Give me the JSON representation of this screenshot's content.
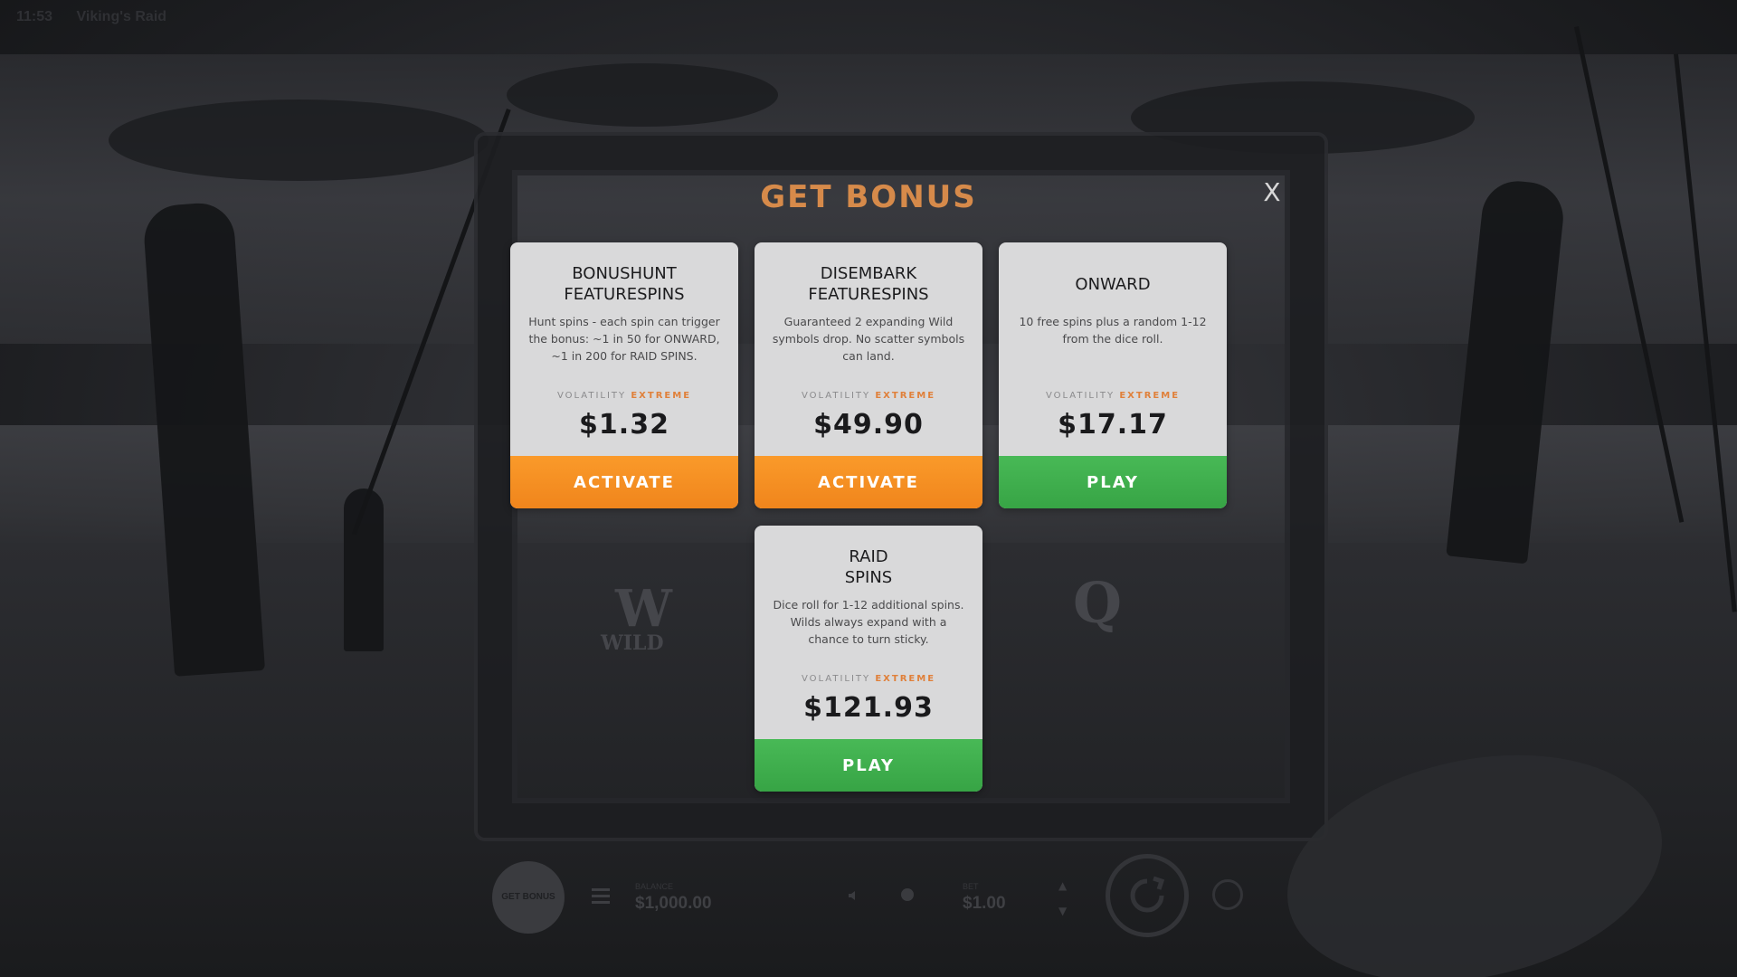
{
  "game": {
    "clock": "11:53",
    "name": "Viking's Raid"
  },
  "background": {
    "reel_symbols": [
      "W",
      "WILD",
      "Q"
    ]
  },
  "controls": {
    "get_bonus": "GET BONUS",
    "balance_label": "BALANCE",
    "balance_value": "$1,000.00",
    "bet_label": "BET",
    "bet_value": "$1.00"
  },
  "modal": {
    "title": "GET BONUS",
    "close": "X",
    "cards": [
      {
        "title": "BONUSHUNT\nFEATURESPINS",
        "description": "Hunt spins - each spin can trigger the bonus: ~1 in 50 for ONWARD, ~1 in 200 for RAID SPINS.",
        "volatility_label": "VOLATILITY",
        "volatility_level": "EXTREME",
        "price": "$1.32",
        "button": "ACTIVATE",
        "button_color": "#f7921f"
      },
      {
        "title": "DISEMBARK\nFEATURESPINS",
        "description": "Guaranteed 2 expanding Wild symbols drop. No scatter symbols can land.",
        "volatility_label": "VOLATILITY",
        "volatility_level": "EXTREME",
        "price": "$49.90",
        "button": "ACTIVATE",
        "button_color": "#f7921f"
      },
      {
        "title": "ONWARD",
        "description": "10 free spins plus a random 1-12 from the dice roll.",
        "volatility_label": "VOLATILITY",
        "volatility_level": "EXTREME",
        "price": "$17.17",
        "button": "PLAY",
        "button_color": "#3fae4d"
      },
      {
        "title": "RAID\nSPINS",
        "description": "Dice roll for 1-12 additional spins. Wilds always expand with a chance to turn sticky.",
        "volatility_label": "VOLATILITY",
        "volatility_level": "EXTREME",
        "price": "$121.93",
        "button": "PLAY",
        "button_color": "#3fae4d"
      }
    ]
  },
  "colors": {
    "title_accent": "#d68a4a",
    "volatility_accent": "#e0803a",
    "card_bg": "#d9d9da"
  }
}
